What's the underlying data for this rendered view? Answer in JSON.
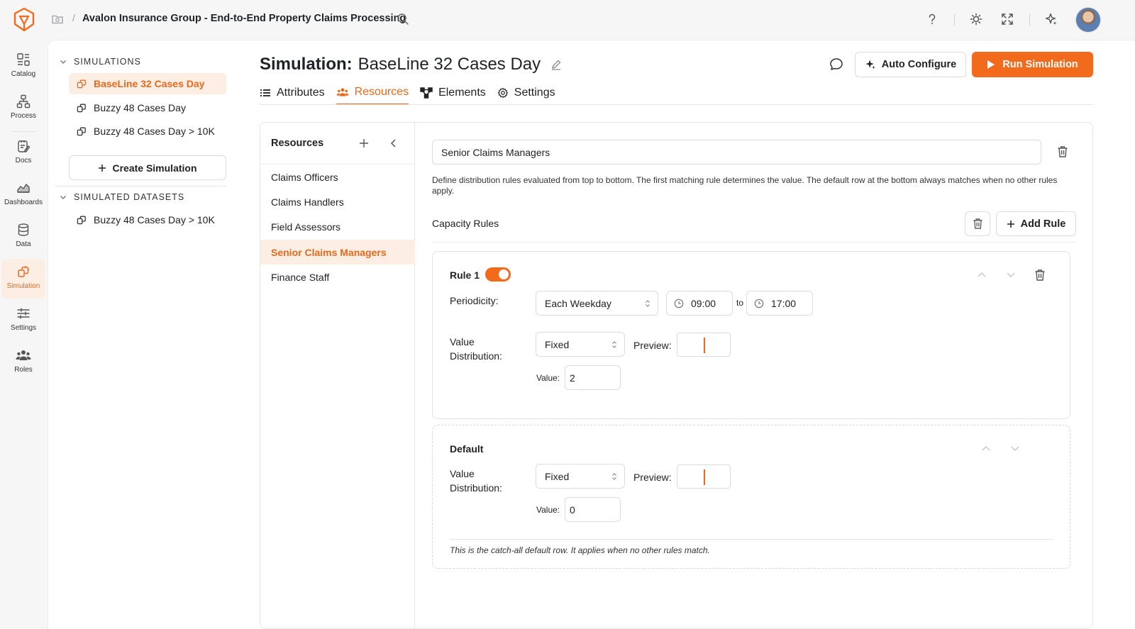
{
  "app": {
    "title": "Avalon Insurance Group - End-to-End Property Claims Processing"
  },
  "rail": {
    "items": [
      {
        "label": "Catalog"
      },
      {
        "label": "Process"
      },
      {
        "label": "Docs"
      },
      {
        "label": "Dashboards"
      },
      {
        "label": "Data"
      },
      {
        "label": "Simulation"
      },
      {
        "label": "Settings"
      },
      {
        "label": "Roles"
      }
    ],
    "active": "Simulation"
  },
  "sidebar": {
    "simulations_heading": "SIMULATIONS",
    "simulations": [
      {
        "label": "BaseLine 32 Cases Day",
        "active": true
      },
      {
        "label": "Buzzy 48 Cases Day",
        "active": false
      },
      {
        "label": "Buzzy 48 Cases Day > 10K",
        "active": false
      }
    ],
    "create_label": "Create Simulation",
    "datasets_heading": "SIMULATED DATASETS",
    "datasets": [
      {
        "label": "Buzzy 48 Cases Day > 10K"
      }
    ]
  },
  "header": {
    "title_label": "Simulation:",
    "title_name": "BaseLine 32 Cases Day",
    "auto_configure": "Auto Configure",
    "run_simulation": "Run Simulation",
    "tabs": [
      {
        "label": "Attributes",
        "icon": "list-icon"
      },
      {
        "label": "Resources",
        "icon": "people-icon",
        "active": true
      },
      {
        "label": "Elements",
        "icon": "nodes-icon"
      },
      {
        "label": "Settings",
        "icon": "gear-icon"
      }
    ]
  },
  "resources": {
    "heading": "Resources",
    "items": [
      {
        "label": "Claims Officers",
        "active": false
      },
      {
        "label": "Claims Handlers",
        "active": false
      },
      {
        "label": "Field Assessors",
        "active": false
      },
      {
        "label": "Senior Claims Managers",
        "active": true
      },
      {
        "label": "Finance Staff",
        "active": false
      }
    ]
  },
  "detail": {
    "name_value": "Senior Claims Managers",
    "help_text": "Define distribution rules evaluated from top to bottom. The first matching rule determines the value. The default row at the bottom always matches when no other rules apply.",
    "capacity_label": "Capacity Rules",
    "add_rule": "Add Rule",
    "rule1": {
      "title": "Rule 1",
      "enabled": true,
      "periodicity_label": "Periodicity:",
      "periodicity_value": "Each Weekday",
      "time_from": "09:00",
      "time_sep": "to",
      "time_to": "17:00",
      "distribution_label_1": "Value",
      "distribution_label_2": "Distribution:",
      "distribution_value": "Fixed",
      "preview_label": "Preview:",
      "value_label": "Value:",
      "value": "2"
    },
    "default": {
      "title": "Default",
      "distribution_label_1": "Value",
      "distribution_label_2": "Distribution:",
      "distribution_value": "Fixed",
      "preview_label": "Preview:",
      "value_label": "Value:",
      "value": "0",
      "note": "This is the catch-all default row. It applies when no other rules match."
    }
  },
  "colors": {
    "accent": "#f26b1d",
    "accent_text": "#e8691c",
    "accent_bg": "#fdeee4"
  }
}
